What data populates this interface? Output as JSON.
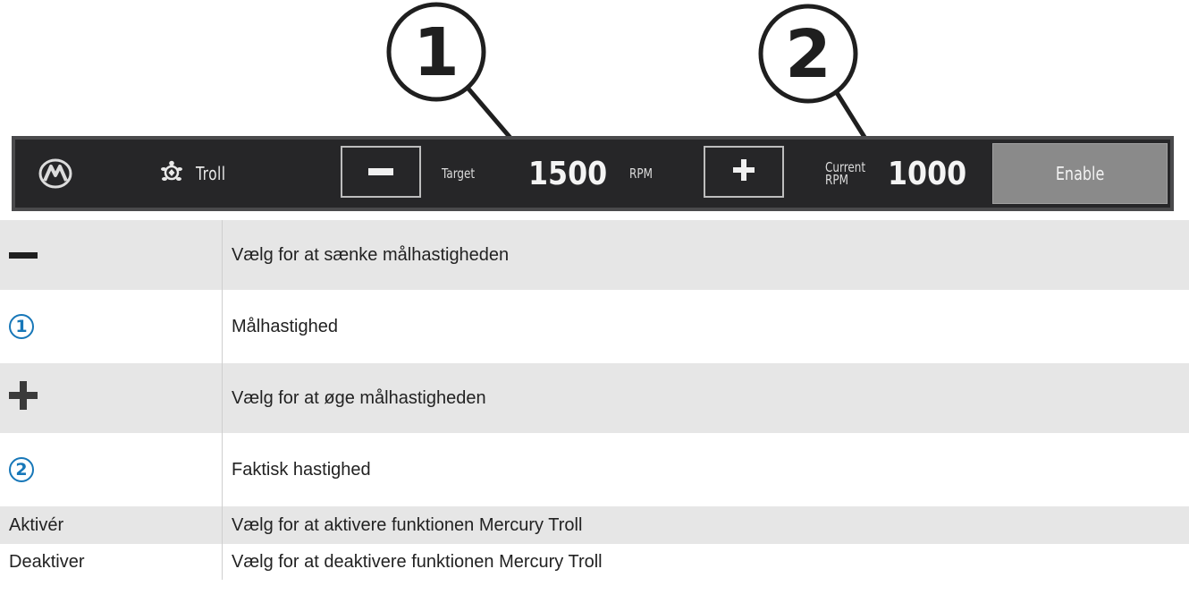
{
  "callouts": [
    "1",
    "2"
  ],
  "bar": {
    "mode_label": "Troll",
    "target_label": "Target",
    "target_value": "1500",
    "rpm_label": "RPM",
    "current_label_line1": "Current",
    "current_label_line2": "RPM",
    "current_value": "1000",
    "enable_label": "Enable",
    "icons": [
      "mercury-logo-icon",
      "turtle-icon",
      "minus-icon",
      "plus-icon"
    ]
  },
  "legend": {
    "rows": [
      {
        "key_icon": "minus-icon",
        "description": "Vælg for at sænke målhastigheden"
      },
      {
        "key_icon": "callout-1-icon",
        "key_text": "1",
        "description": "Målhastighed"
      },
      {
        "key_icon": "plus-icon",
        "description": "Vælg for at øge målhastigheden"
      },
      {
        "key_icon": "callout-2-icon",
        "key_text": "2",
        "description": "Faktisk hastighed"
      },
      {
        "key": "Aktivér",
        "description": "Vælg for at aktivere funktionen Mercury Troll"
      },
      {
        "key": "Deaktiver",
        "description": "Vælg for at deaktivere funktionen Mercury Troll"
      }
    ]
  },
  "colors": {
    "bar_background": "#262628",
    "enable_button": "#8a8a8a",
    "callout_accent": "#1777b8",
    "table_shade": "#e6e6e6"
  }
}
